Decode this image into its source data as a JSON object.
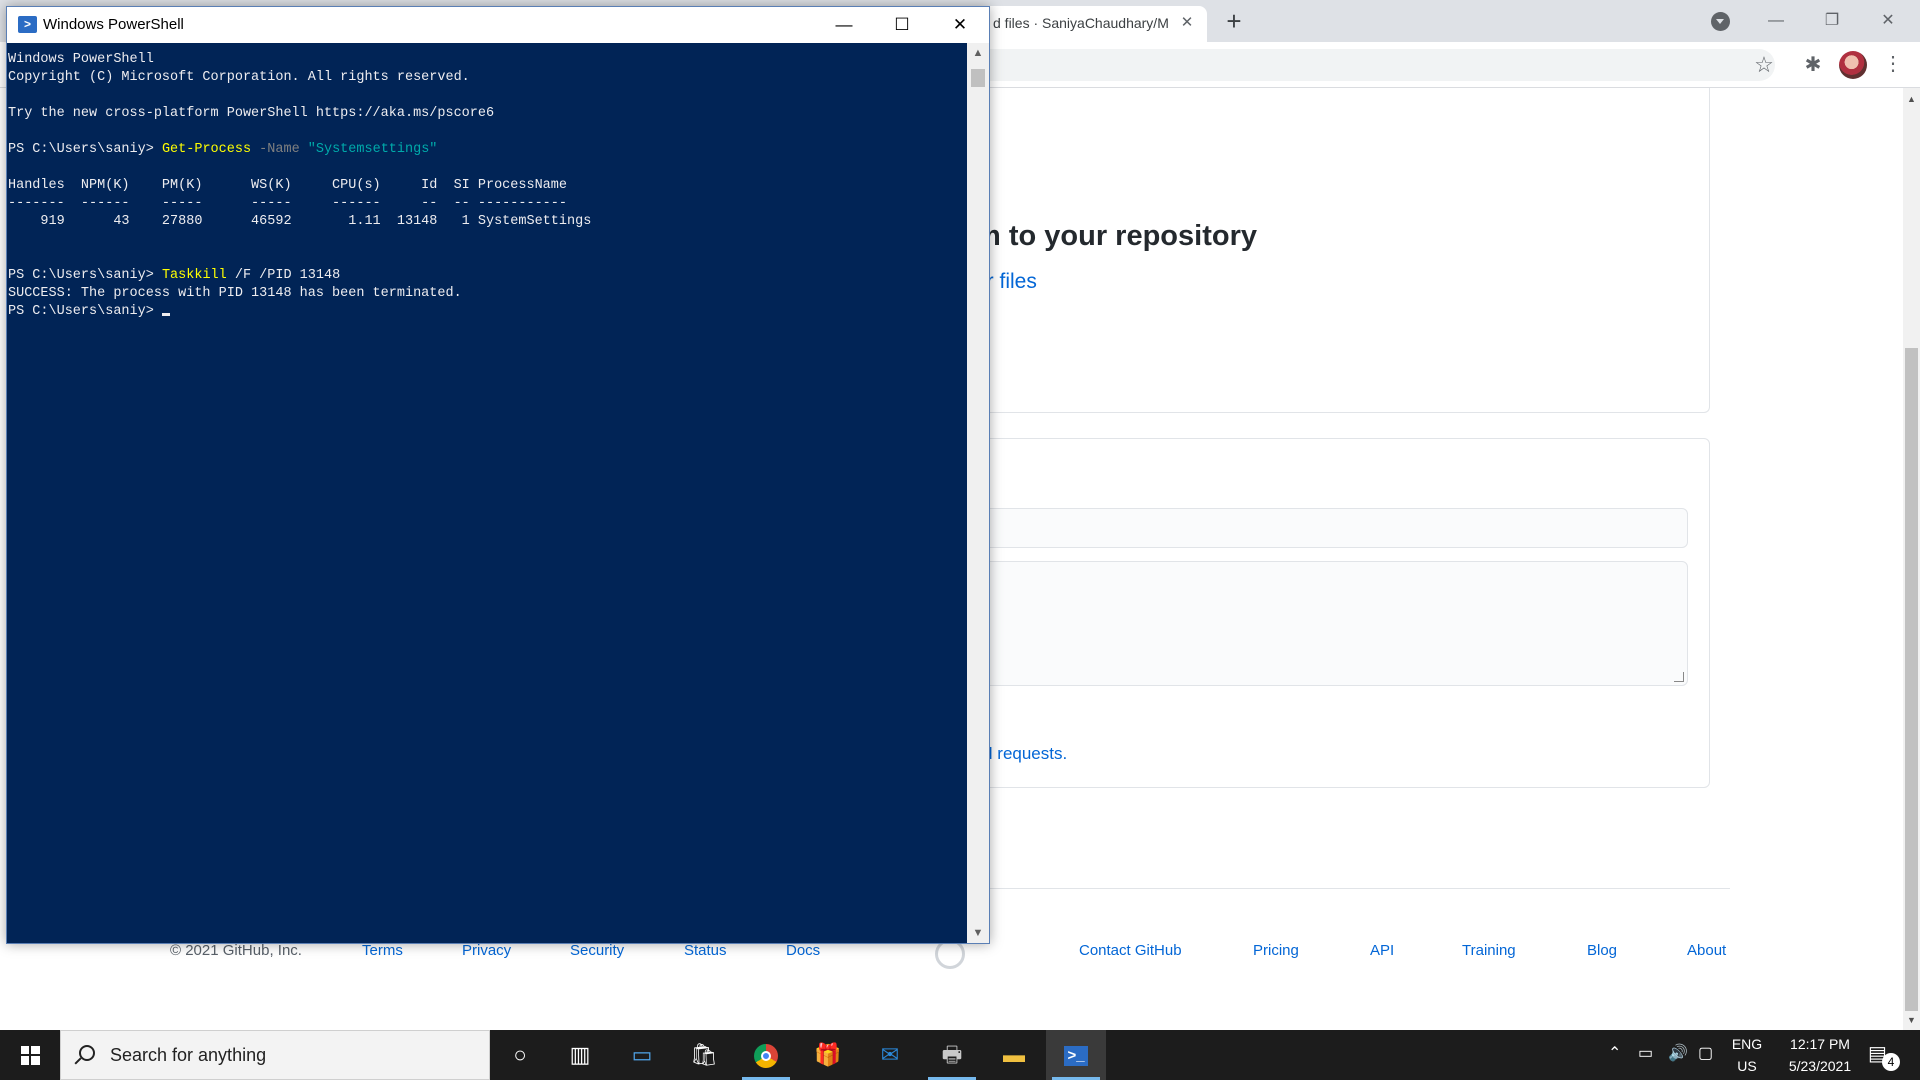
{
  "browser": {
    "tab_title": "d files · SaniyaChaudhary/M",
    "tab_close": "✕",
    "new_tab": "+",
    "window_controls": {
      "minimize": "—",
      "restore": "❐",
      "close": "✕"
    },
    "star_icon": "☆",
    "extensions_icon": "✱",
    "menu_icon": "⋮"
  },
  "github": {
    "heading": "m to your repository",
    "upload_link": "ur files",
    "pr_link": "ll requests.",
    "footer": {
      "copyright": "© 2021 GitHub, Inc.",
      "links": [
        "Terms",
        "Privacy",
        "Security",
        "Status",
        "Docs",
        "Contact GitHub",
        "Pricing",
        "API",
        "Training",
        "Blog",
        "About"
      ]
    }
  },
  "powershell": {
    "title": "Windows PowerShell",
    "controls": {
      "minimize": "—",
      "maximize": "☐",
      "close": "✕"
    },
    "lines": {
      "l1": "Windows PowerShell",
      "l2": "Copyright (C) Microsoft Corporation. All rights reserved.",
      "l3": "",
      "l4": "Try the new cross-platform PowerShell https://aka.ms/pscore6",
      "l5": "",
      "prompt": "PS C:\\Users\\saniy> ",
      "cmd1": "Get-Process",
      "cmd1_param": " -Name ",
      "cmd1_arg": "\"Systemsettings\"",
      "l7": "",
      "table_header": "Handles  NPM(K)    PM(K)      WS(K)     CPU(s)     Id  SI ProcessName",
      "table_rule": "-------  ------    -----      -----     ------     --  -- -----------",
      "table_row": "    919      43    27880      46592       1.11  13148   1 SystemSettings",
      "cmd2": "Taskkill",
      "cmd2_args": " /F /PID 13148",
      "result": "SUCCESS: The process with PID 13148 has been terminated."
    }
  },
  "taskbar": {
    "search_placeholder": "Search for anything",
    "apps": [
      "cortana-icon",
      "task-view-icon",
      "desktop-app-icon",
      "store-icon",
      "chrome-icon",
      "gift-icon",
      "mail-icon",
      "printer-icon",
      "file-explorer-icon",
      "powershell-icon"
    ],
    "tray": {
      "language": "ENG",
      "region": "US",
      "time": "12:17 PM",
      "date": "5/23/2021",
      "notifications": "4"
    }
  }
}
